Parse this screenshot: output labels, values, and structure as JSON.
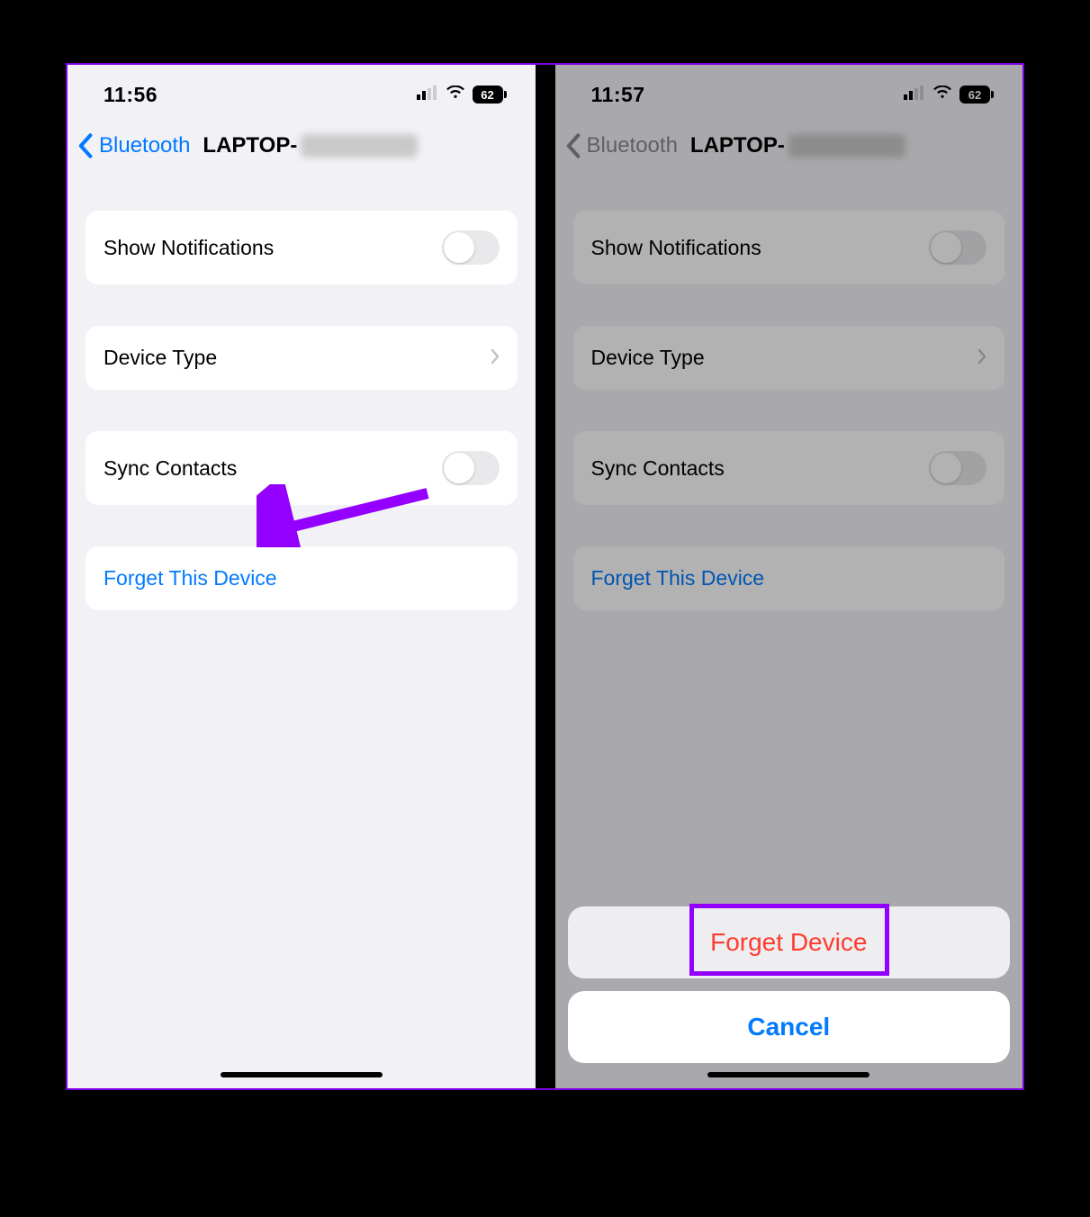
{
  "statusbar": {
    "time_left": "11:56",
    "time_right": "11:57",
    "battery": "62"
  },
  "nav": {
    "back_label": "Bluetooth",
    "title_prefix": "LAPTOP-"
  },
  "rows": {
    "show_notifications": "Show Notifications",
    "device_type": "Device Type",
    "sync_contacts": "Sync Contacts",
    "forget_link": "Forget This Device"
  },
  "sheet": {
    "forget": "Forget Device",
    "cancel": "Cancel"
  },
  "colors": {
    "ios_blue": "#007aff",
    "ios_red": "#ff3b30",
    "annotation_purple": "#9300ff"
  }
}
